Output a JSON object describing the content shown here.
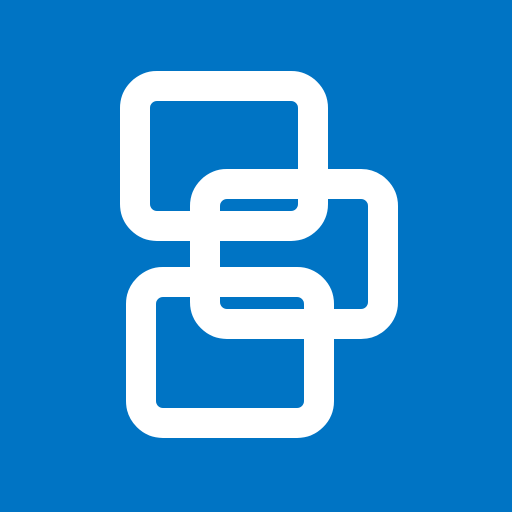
{
  "icon": {
    "name": "overlapping-windows-icon",
    "background_color": "#0074C4",
    "stroke_color": "#FFFFFF"
  }
}
